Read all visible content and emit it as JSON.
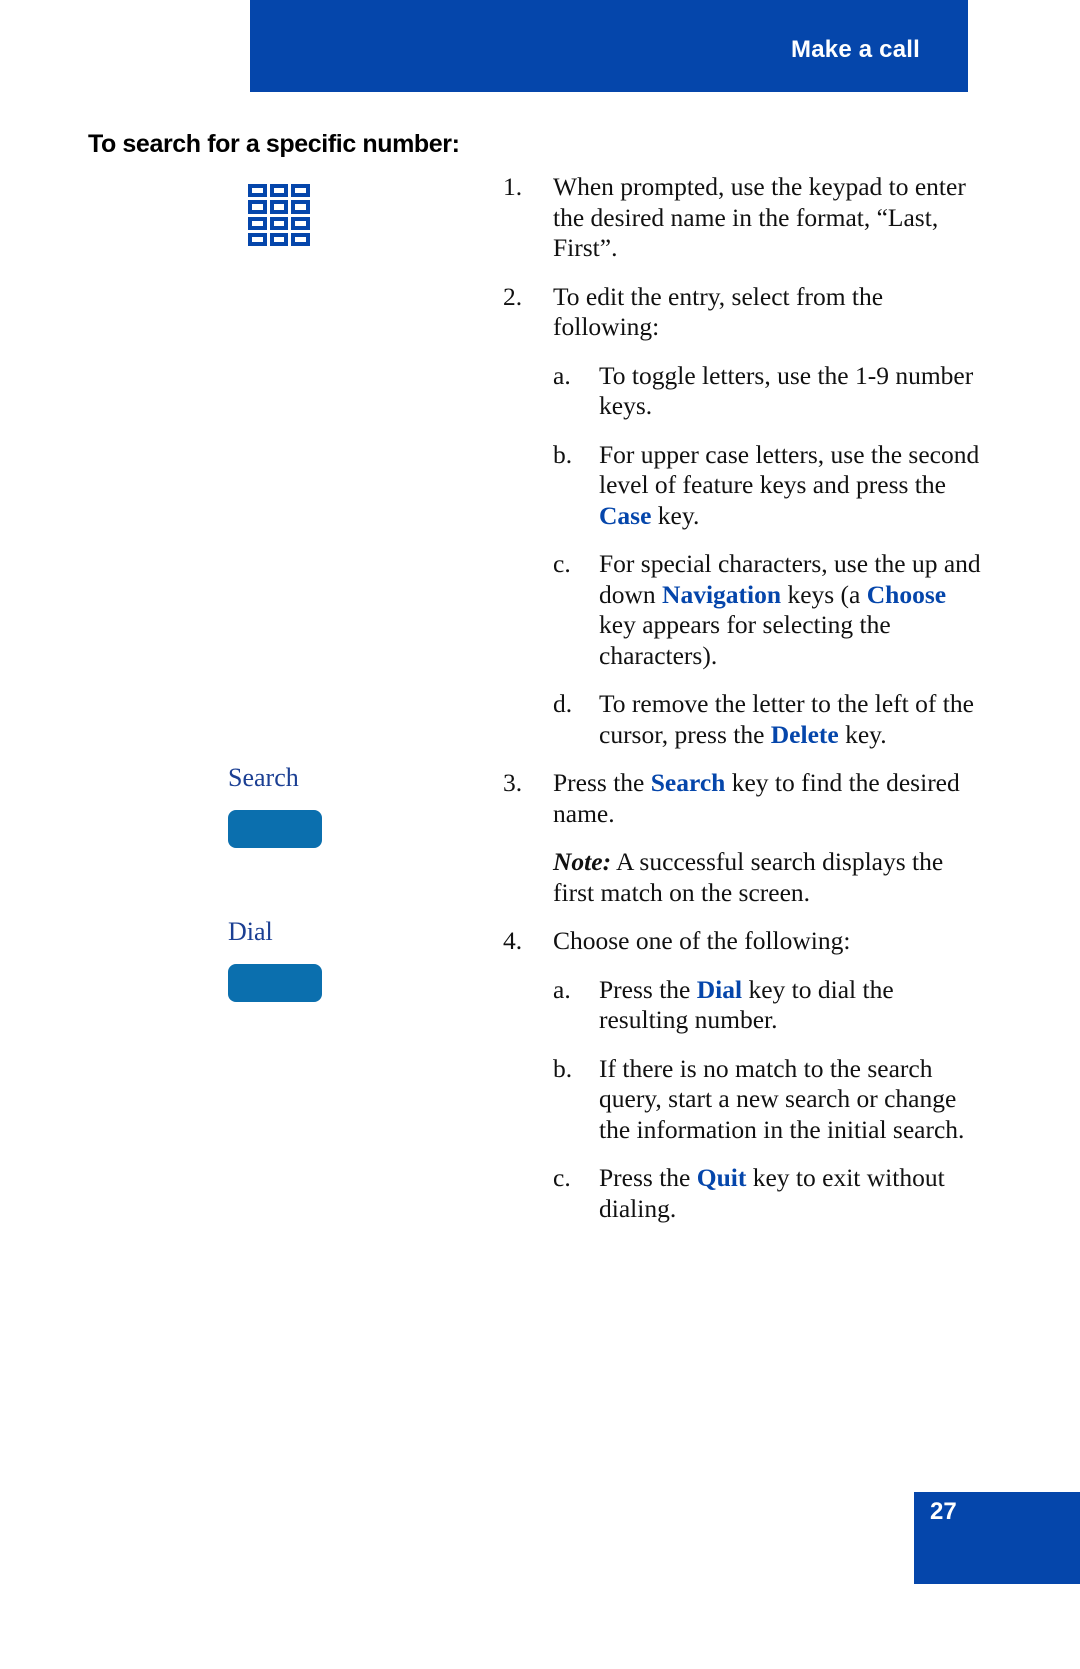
{
  "header": {
    "title": "Make a call",
    "band_color": "#0546ab"
  },
  "section": {
    "heading": "To search for a specific number:"
  },
  "left_column": {
    "keypad_icon_name": "keypad-icon",
    "keys": [
      {
        "label": "Search",
        "icon": "softkey-button"
      },
      {
        "label": "Dial",
        "icon": "softkey-button"
      }
    ],
    "key_color": "#0b6fae",
    "label_color": "#1b3f93"
  },
  "steps": [
    {
      "num": "1.",
      "parts": [
        {
          "t": "When prompted, use the keypad to enter the desired name in the format, “Last, First”."
        }
      ]
    },
    {
      "num": "2.",
      "parts": [
        {
          "t": "To edit the entry, select from the following:"
        }
      ],
      "substeps": [
        {
          "num": "a.",
          "parts": [
            {
              "t": "To toggle letters, use the 1-9 number keys."
            }
          ]
        },
        {
          "num": "b.",
          "parts": [
            {
              "t": "For upper case letters, use the second level of feature keys and press the "
            },
            {
              "t": "Case",
              "kw": true
            },
            {
              "t": " key."
            }
          ]
        },
        {
          "num": "c.",
          "parts": [
            {
              "t": "For special characters, use the up and down "
            },
            {
              "t": "Navigation",
              "kw": true
            },
            {
              "t": " keys (a "
            },
            {
              "t": "Choose",
              "kw": true
            },
            {
              "t": " key appears for selecting the characters)."
            }
          ]
        },
        {
          "num": "d.",
          "parts": [
            {
              "t": "To remove the letter to the left of the cursor, press the "
            },
            {
              "t": "Delete",
              "kw": true
            },
            {
              "t": " key."
            }
          ]
        }
      ]
    },
    {
      "num": "3.",
      "parts": [
        {
          "t": "Press the "
        },
        {
          "t": "Search",
          "kw": true
        },
        {
          "t": " key to find the desired name."
        }
      ],
      "note": {
        "label": "Note:",
        "text": " A successful search displays the first match on the screen."
      }
    },
    {
      "num": "4.",
      "parts": [
        {
          "t": "Choose one of the following:"
        }
      ],
      "substeps": [
        {
          "num": "a.",
          "parts": [
            {
              "t": "Press the "
            },
            {
              "t": "Dial",
              "kw": true
            },
            {
              "t": " key to dial the resulting number."
            }
          ]
        },
        {
          "num": "b.",
          "parts": [
            {
              "t": "If there is no match to the search query, start a new search or change the information in the initial search."
            }
          ]
        },
        {
          "num": "c.",
          "parts": [
            {
              "t": "Press the "
            },
            {
              "t": "Quit",
              "kw": true
            },
            {
              "t": " key to exit without dialing."
            }
          ]
        }
      ]
    }
  ],
  "footer": {
    "page_number": "27",
    "band_color": "#0546ab"
  }
}
